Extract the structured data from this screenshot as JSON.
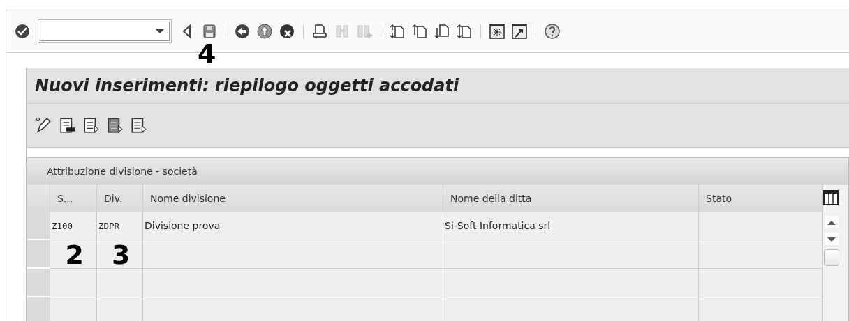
{
  "toolbar": {
    "buttons": [
      {
        "kind": "back-triangle",
        "disabled": false
      },
      {
        "kind": "save",
        "disabled": false,
        "callout": "4"
      },
      {
        "kind": "sep"
      },
      {
        "kind": "back",
        "disabled": false
      },
      {
        "kind": "up",
        "disabled": false
      },
      {
        "kind": "cancel",
        "disabled": false
      },
      {
        "kind": "sep"
      },
      {
        "kind": "print",
        "disabled": false
      },
      {
        "kind": "find",
        "disabled": true
      },
      {
        "kind": "find-next",
        "disabled": true
      },
      {
        "kind": "sep"
      },
      {
        "kind": "first-page",
        "disabled": false
      },
      {
        "kind": "prev-page",
        "disabled": false
      },
      {
        "kind": "next-page",
        "disabled": false
      },
      {
        "kind": "last-page",
        "disabled": false
      },
      {
        "kind": "sep"
      },
      {
        "kind": "new-session",
        "disabled": false
      },
      {
        "kind": "shortcut",
        "disabled": false
      },
      {
        "kind": "sep"
      },
      {
        "kind": "help",
        "disabled": false
      }
    ]
  },
  "title": "Nuovi inserimenti: riepilogo oggetti accodati",
  "app_toolbar": [
    {
      "kind": "edit"
    },
    {
      "kind": "detail"
    },
    {
      "kind": "select-all"
    },
    {
      "kind": "select-block"
    },
    {
      "kind": "deselect"
    }
  ],
  "table": {
    "caption": "Attribuzione divisione - società",
    "columns": [
      {
        "label": "S...",
        "callout": "2"
      },
      {
        "label": "Div.",
        "callout": "3"
      },
      {
        "label": "Nome divisione"
      },
      {
        "label": "Nome della ditta"
      },
      {
        "label": "Stato"
      }
    ],
    "rows": [
      {
        "cells": [
          "Z100",
          "ZDPR",
          "Divisione prova",
          "Si-Soft Informatica srl"
        ],
        "selected": false
      }
    ]
  }
}
